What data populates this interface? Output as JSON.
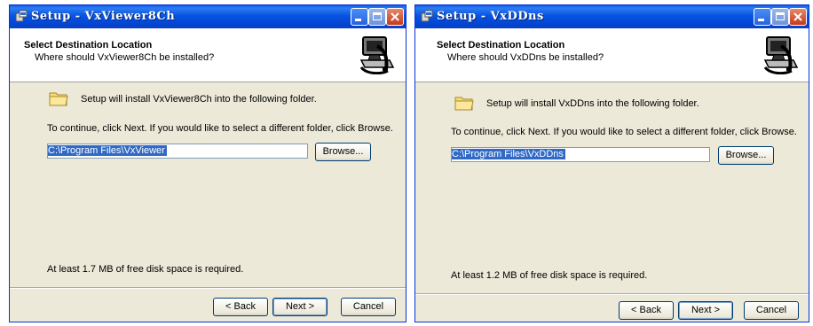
{
  "windows": [
    {
      "title": "Setup - VxViewer8Ch",
      "header_title": "Select Destination Location",
      "header_subtitle": "Where should VxViewer8Ch be installed?",
      "info_text": "Setup will install VxViewer8Ch into the following folder.",
      "instruction": "To continue, click Next. If you would like to select a different folder, click Browse.",
      "path_value": "C:\\Program Files\\VxViewer",
      "browse_label": "Browse...",
      "disk_space": "At least 1.7 MB of free disk space is required.",
      "back_label": "< Back",
      "next_label": "Next >",
      "cancel_label": "Cancel"
    },
    {
      "title": "Setup - VxDDns",
      "header_title": "Select Destination Location",
      "header_subtitle": "Where should VxDDns be installed?",
      "info_text": "Setup will install VxDDns into the following folder.",
      "instruction": "To continue, click Next. If you would like to select a different folder, click Browse.",
      "path_value": "C:\\Program Files\\VxDDns",
      "browse_label": "Browse...",
      "disk_space": "At least 1.2 MB of free disk space is required.",
      "back_label": "< Back",
      "next_label": "Next >",
      "cancel_label": "Cancel"
    }
  ],
  "icons": {
    "app": "setup-app-icon",
    "header": "computer-install-icon",
    "folder": "folder-icon",
    "minimize": "minimize-icon",
    "maximize": "maximize-icon",
    "close": "close-icon"
  },
  "colors": {
    "titlebar": "#0a5fe6",
    "dialog_bg": "#ece9d8",
    "selection": "#316ac5",
    "close_button": "#c5391c"
  }
}
